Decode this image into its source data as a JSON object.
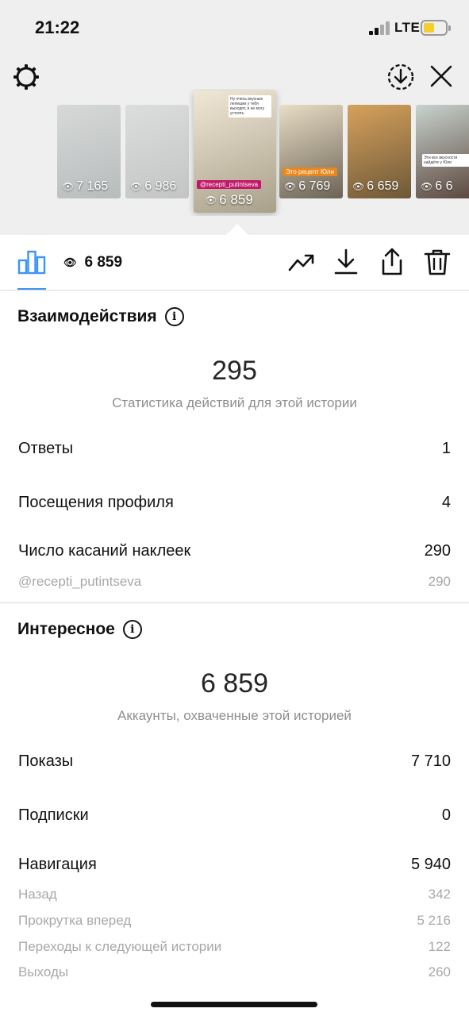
{
  "status_bar": {
    "time": "21:22",
    "network": "LTE"
  },
  "stories": [
    {
      "views": "7 165",
      "colors": [
        "#d7d9d9",
        "#b9bcbc"
      ]
    },
    {
      "views": "6 986",
      "colors": [
        "#dcdedd",
        "#c2c5c4"
      ]
    },
    {
      "views": "6 859",
      "colors": [
        "#f0e8d6",
        "#a9a08a"
      ],
      "tag": "@recepti_putintseva",
      "note": "Ну очень вкусные лепешки у тебя выходят, я не могу устоять",
      "active": true
    },
    {
      "views": "6 769",
      "colors": [
        "#e8ddc5",
        "#6b6355"
      ],
      "tag": "Это рецепт Юли"
    },
    {
      "views": "6 659",
      "colors": [
        "#d6a25c",
        "#6d5838"
      ]
    },
    {
      "views": "6 6",
      "colors": [
        "#c8d3cf",
        "#59443a"
      ],
      "note": "Эти все вкусности найдёте у Юли"
    }
  ],
  "toolbar": {
    "views": "6 859"
  },
  "interactions": {
    "title": "Взаимодействия",
    "total": "295",
    "subtitle": "Статистика действий для этой истории",
    "rows": [
      {
        "label": "Ответы",
        "value": "1"
      },
      {
        "label": "Посещения профиля",
        "value": "4"
      },
      {
        "label": "Число касаний наклеек",
        "value": "290"
      }
    ],
    "sub_rows": [
      {
        "label": "@recepti_putintseva",
        "value": "290"
      }
    ]
  },
  "discovery": {
    "title": "Интересное",
    "total": "6 859",
    "subtitle": "Аккаунты, охваченные этой историей",
    "rows": [
      {
        "label": "Показы",
        "value": "7 710"
      },
      {
        "label": "Подписки",
        "value": "0"
      },
      {
        "label": "Навигация",
        "value": "5 940"
      }
    ],
    "sub_rows": [
      {
        "label": "Назад",
        "value": "342"
      },
      {
        "label": "Прокрутка вперед",
        "value": "5 216"
      },
      {
        "label": "Переходы к следующей истории",
        "value": "122"
      },
      {
        "label": "Выходы",
        "value": "260"
      }
    ]
  },
  "colors": {
    "accent": "#3b95f5",
    "muted": "#8e8e8e",
    "sticker": "#c2186a",
    "top_bg": "#efefef"
  }
}
